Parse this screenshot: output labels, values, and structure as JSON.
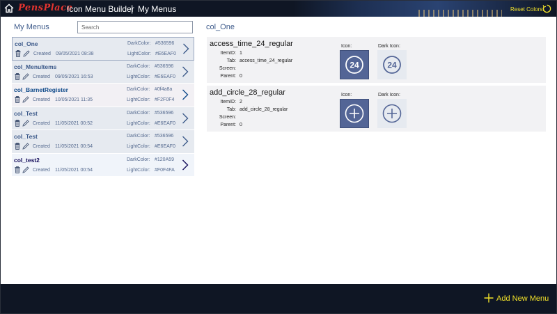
{
  "header": {
    "logo_text": "PensPlace",
    "app_title": "Icon Menu Builder",
    "separator": "|",
    "page_title": "My Menus",
    "reset_label": "Reset Colors:",
    "accent_color": "#f2e22a"
  },
  "left": {
    "title": "My Menus",
    "search_placeholder": "Search",
    "created_label": "Created",
    "dark_label": "DarkColor:",
    "light_label": "LightColor:",
    "rows": [
      {
        "name": "col_One",
        "created": "09/05/2021 08:38",
        "dark": "#536596",
        "light": "#E6EAF0",
        "bg": "#e6eaf0",
        "name_color": "#3d5a8a",
        "selected": true
      },
      {
        "name": "col_MenuItems",
        "created": "09/05/2021 16:53",
        "dark": "#536596",
        "light": "#E6EAF0",
        "bg": "#e6eaf0",
        "name_color": "#3d5a8a",
        "selected": false
      },
      {
        "name": "col_BarnetRegister",
        "created": "10/05/2021 11:35",
        "dark": "#0f4a8a",
        "light": "#F2F0F4",
        "bg": "#f2f0f4",
        "name_color": "#0f4a8a",
        "selected": false
      },
      {
        "name": "col_Test",
        "created": "11/05/2021 00:52",
        "dark": "#536596",
        "light": "#E6EAF0",
        "bg": "#e6eaf0",
        "name_color": "#3d5a8a",
        "selected": false
      },
      {
        "name": "col_Test",
        "created": "11/05/2021 00:54",
        "dark": "#536596",
        "light": "#E6EAF0",
        "bg": "#e6eaf0",
        "name_color": "#3d5a8a",
        "selected": false
      },
      {
        "name": "col_test2",
        "created": "11/05/2021 00:54",
        "dark": "#120A59",
        "light": "#F0F4FA",
        "bg": "#f0f4fa",
        "name_color": "#120a59",
        "selected": false
      }
    ]
  },
  "right": {
    "title": "col_One",
    "field_labels": {
      "item_id": "ItemID:",
      "tab": "Tab:",
      "screen": "Screen:",
      "parent": "Parent:"
    },
    "icon_label": "Icon:",
    "dark_icon_label": "Dark Icon:",
    "items": [
      {
        "name": "access_time_24_regular",
        "item_id": "1",
        "tab": "access_time_24_regular",
        "screen": "",
        "parent": "0",
        "icon": "clock-24-icon"
      },
      {
        "name": "add_circle_28_regular",
        "item_id": "2",
        "tab": "add_circle_28_regular",
        "screen": "",
        "parent": "0",
        "icon": "add-circle-icon"
      }
    ],
    "icon_glyph_text": "24"
  },
  "footer": {
    "add_label": "Add New Menu"
  }
}
